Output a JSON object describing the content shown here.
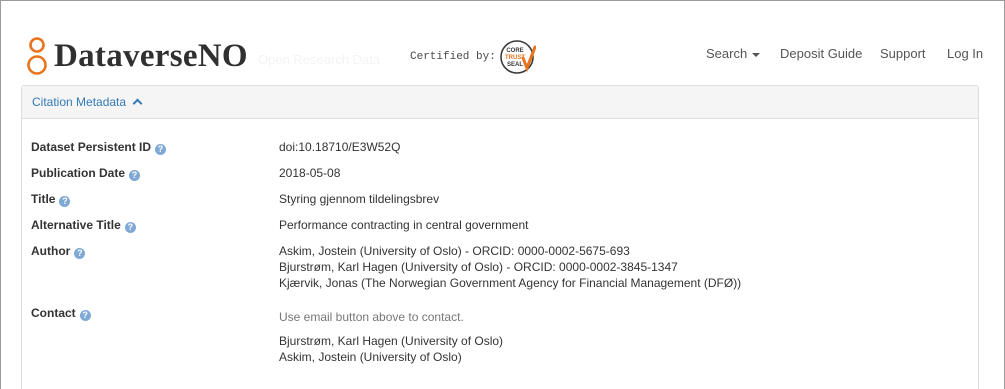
{
  "header": {
    "logo_text": "DataverseNO",
    "tagline": "Open Research Data",
    "certified_label": "Certified by:",
    "badge_lines": [
      "CORE",
      "TRUST",
      "SEAL"
    ],
    "nav": {
      "search": "Search",
      "deposit_guide": "Deposit Guide",
      "support": "Support",
      "login": "Log In"
    }
  },
  "panel": {
    "heading": "Citation Metadata"
  },
  "fields": {
    "pid_label": "Dataset Persistent ID",
    "pid_value": "doi:10.18710/E3W52Q",
    "pubdate_label": "Publication Date",
    "pubdate_value": "2018-05-08",
    "title_label": "Title",
    "title_value": "Styring gjennom tildelingsbrev",
    "alt_title_label": "Alternative Title",
    "alt_title_value": "Performance contracting in central government",
    "author_label": "Author",
    "authors": [
      "Askim, Jostein (University of Oslo) - ORCID: 0000-0002-5675-693",
      "Bjurstrøm, Karl Hagen (University of Oslo) - ORCID: 0000-0002-3845-1347",
      "Kjærvik, Jonas (The Norwegian Government Agency for Financial Management (DFØ))"
    ],
    "contact_label": "Contact",
    "contact_hint": "Use email button above to contact.",
    "contacts": [
      "Bjurstrøm, Karl Hagen (University of Oslo)",
      "Askim, Jostein (University of Oslo)"
    ]
  },
  "colors": {
    "link": "#337ab7",
    "logo_orange": "#e8741e",
    "badge_orange": "#e8741e",
    "help_icon": "#7fa9d4"
  }
}
